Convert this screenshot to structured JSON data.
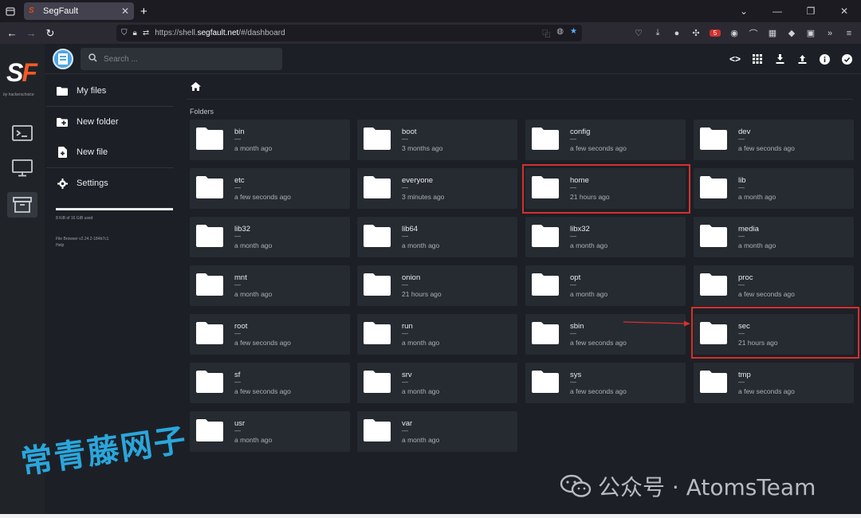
{
  "browser": {
    "tab_title": "SegFault",
    "url_prefix": "https://shell.",
    "url_domain": "segfault.net",
    "url_path": "/#/dashboard",
    "extension_badge": "5"
  },
  "app": {
    "logo_left": "S",
    "logo_right": "F",
    "logo_tagline": "by hackerschoice",
    "search_placeholder": "Search ...",
    "sidebar": {
      "my_files": "My files",
      "new_folder": "New folder",
      "new_file": "New file",
      "settings": "Settings",
      "usage": "8 KiB of 16 GiB used",
      "usage_fraction": 0.0,
      "credits_line1": "File Browser v2.24.2-184b7c1",
      "credits_line2": "Help"
    },
    "section_label": "Folders",
    "folders": [
      {
        "name": "bin",
        "size": "—",
        "date": "a month ago"
      },
      {
        "name": "boot",
        "size": "—",
        "date": "3 months ago"
      },
      {
        "name": "config",
        "size": "—",
        "date": "a few seconds ago"
      },
      {
        "name": "dev",
        "size": "—",
        "date": "a few seconds ago"
      },
      {
        "name": "etc",
        "size": "—",
        "date": "a few seconds ago"
      },
      {
        "name": "everyone",
        "size": "—",
        "date": "3 minutes ago"
      },
      {
        "name": "home",
        "size": "—",
        "date": "21 hours ago"
      },
      {
        "name": "lib",
        "size": "—",
        "date": "a month ago"
      },
      {
        "name": "lib32",
        "size": "—",
        "date": "a month ago"
      },
      {
        "name": "lib64",
        "size": "—",
        "date": "a month ago"
      },
      {
        "name": "libx32",
        "size": "—",
        "date": "a month ago"
      },
      {
        "name": "media",
        "size": "—",
        "date": "a month ago"
      },
      {
        "name": "mnt",
        "size": "—",
        "date": "a month ago"
      },
      {
        "name": "onion",
        "size": "—",
        "date": "21 hours ago"
      },
      {
        "name": "opt",
        "size": "—",
        "date": "a month ago"
      },
      {
        "name": "proc",
        "size": "—",
        "date": "a few seconds ago"
      },
      {
        "name": "root",
        "size": "—",
        "date": "a few seconds ago"
      },
      {
        "name": "run",
        "size": "—",
        "date": "a month ago"
      },
      {
        "name": "sbin",
        "size": "—",
        "date": "a few seconds ago"
      },
      {
        "name": "sec",
        "size": "—",
        "date": "21 hours ago"
      },
      {
        "name": "sf",
        "size": "—",
        "date": "a few seconds ago"
      },
      {
        "name": "srv",
        "size": "—",
        "date": "a month ago"
      },
      {
        "name": "sys",
        "size": "—",
        "date": "a few seconds ago"
      },
      {
        "name": "tmp",
        "size": "—",
        "date": "a few seconds ago"
      },
      {
        "name": "usr",
        "size": "—",
        "date": "a month ago"
      },
      {
        "name": "var",
        "size": "—",
        "date": "a month ago"
      }
    ]
  },
  "watermarks": {
    "chinese_overlay": "常青藤网子",
    "wechat_label": "公众号 · AtomsTeam"
  },
  "colors": {
    "background": "#1c2026",
    "card": "#262b31",
    "highlight": "#d6302b",
    "brand_orange": "#f25a25"
  }
}
